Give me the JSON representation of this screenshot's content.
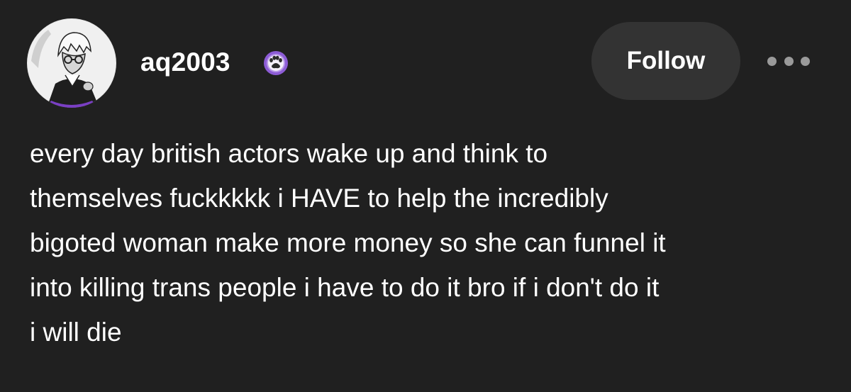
{
  "post": {
    "author": {
      "username": "aq2003",
      "avatar_icon": "avatar-illustration",
      "badge_icon": "paw-badge-icon",
      "badge_color": "#8d5cd6"
    },
    "actions": {
      "follow_label": "Follow",
      "more_icon": "more-dots-icon"
    },
    "body": "every day british actors wake up and think to\nthemselves fuckkkkk i HAVE to help the incredibly\nbigoted woman make more money so she can funnel it\ninto killing trans people i have to do it bro if i don't do it\ni will die"
  },
  "colors": {
    "background": "#202020",
    "button_bg": "#333333",
    "text": "#ffffff",
    "muted": "#9a9a9a"
  }
}
